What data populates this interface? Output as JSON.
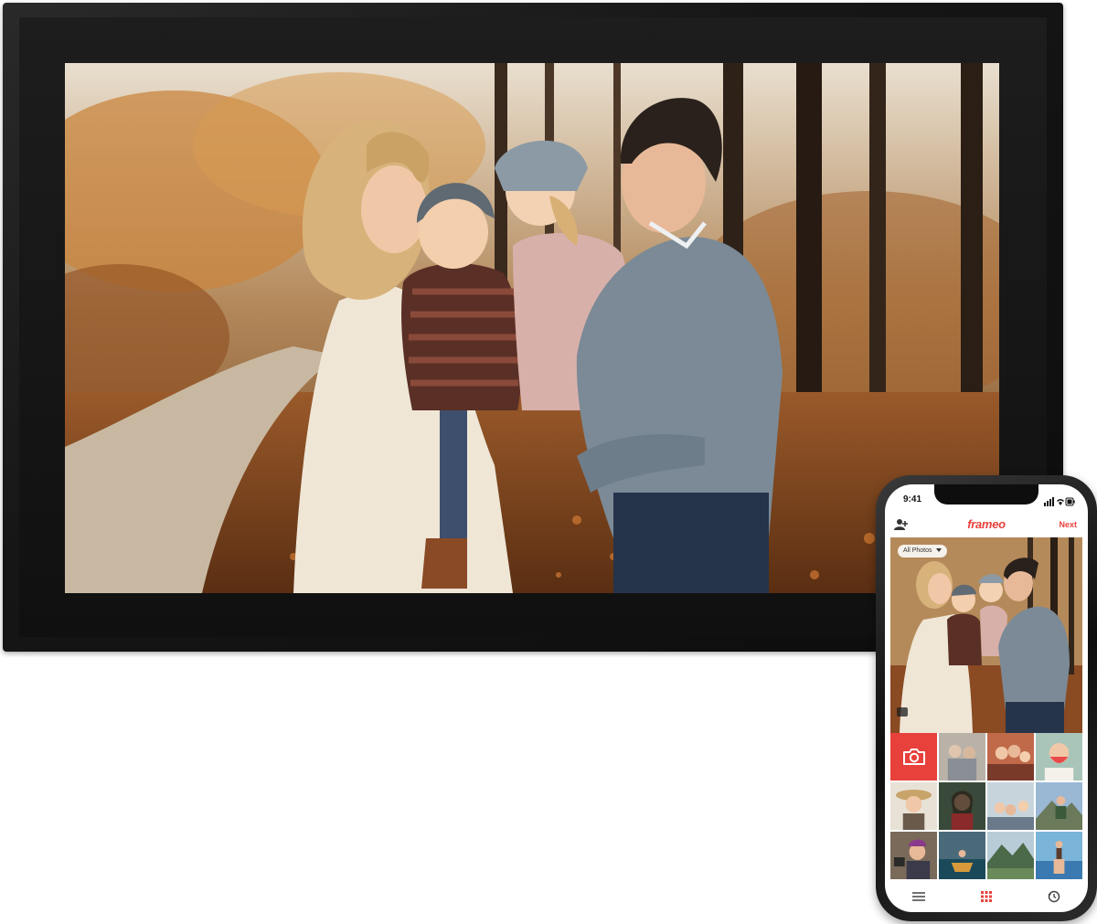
{
  "phone": {
    "status": {
      "time": "9:41"
    },
    "header": {
      "brand": "frameo",
      "next_label": "Next"
    },
    "album_select": {
      "selected": "All Photos"
    },
    "accent_color": "#e8413c"
  },
  "icons": {
    "add_user": "person-plus-icon",
    "album_dropdown": "chevron-down-icon",
    "camera": "camera-icon",
    "menu": "hamburger-menu-icon",
    "gallery": "grid-icon",
    "history": "history-icon"
  }
}
